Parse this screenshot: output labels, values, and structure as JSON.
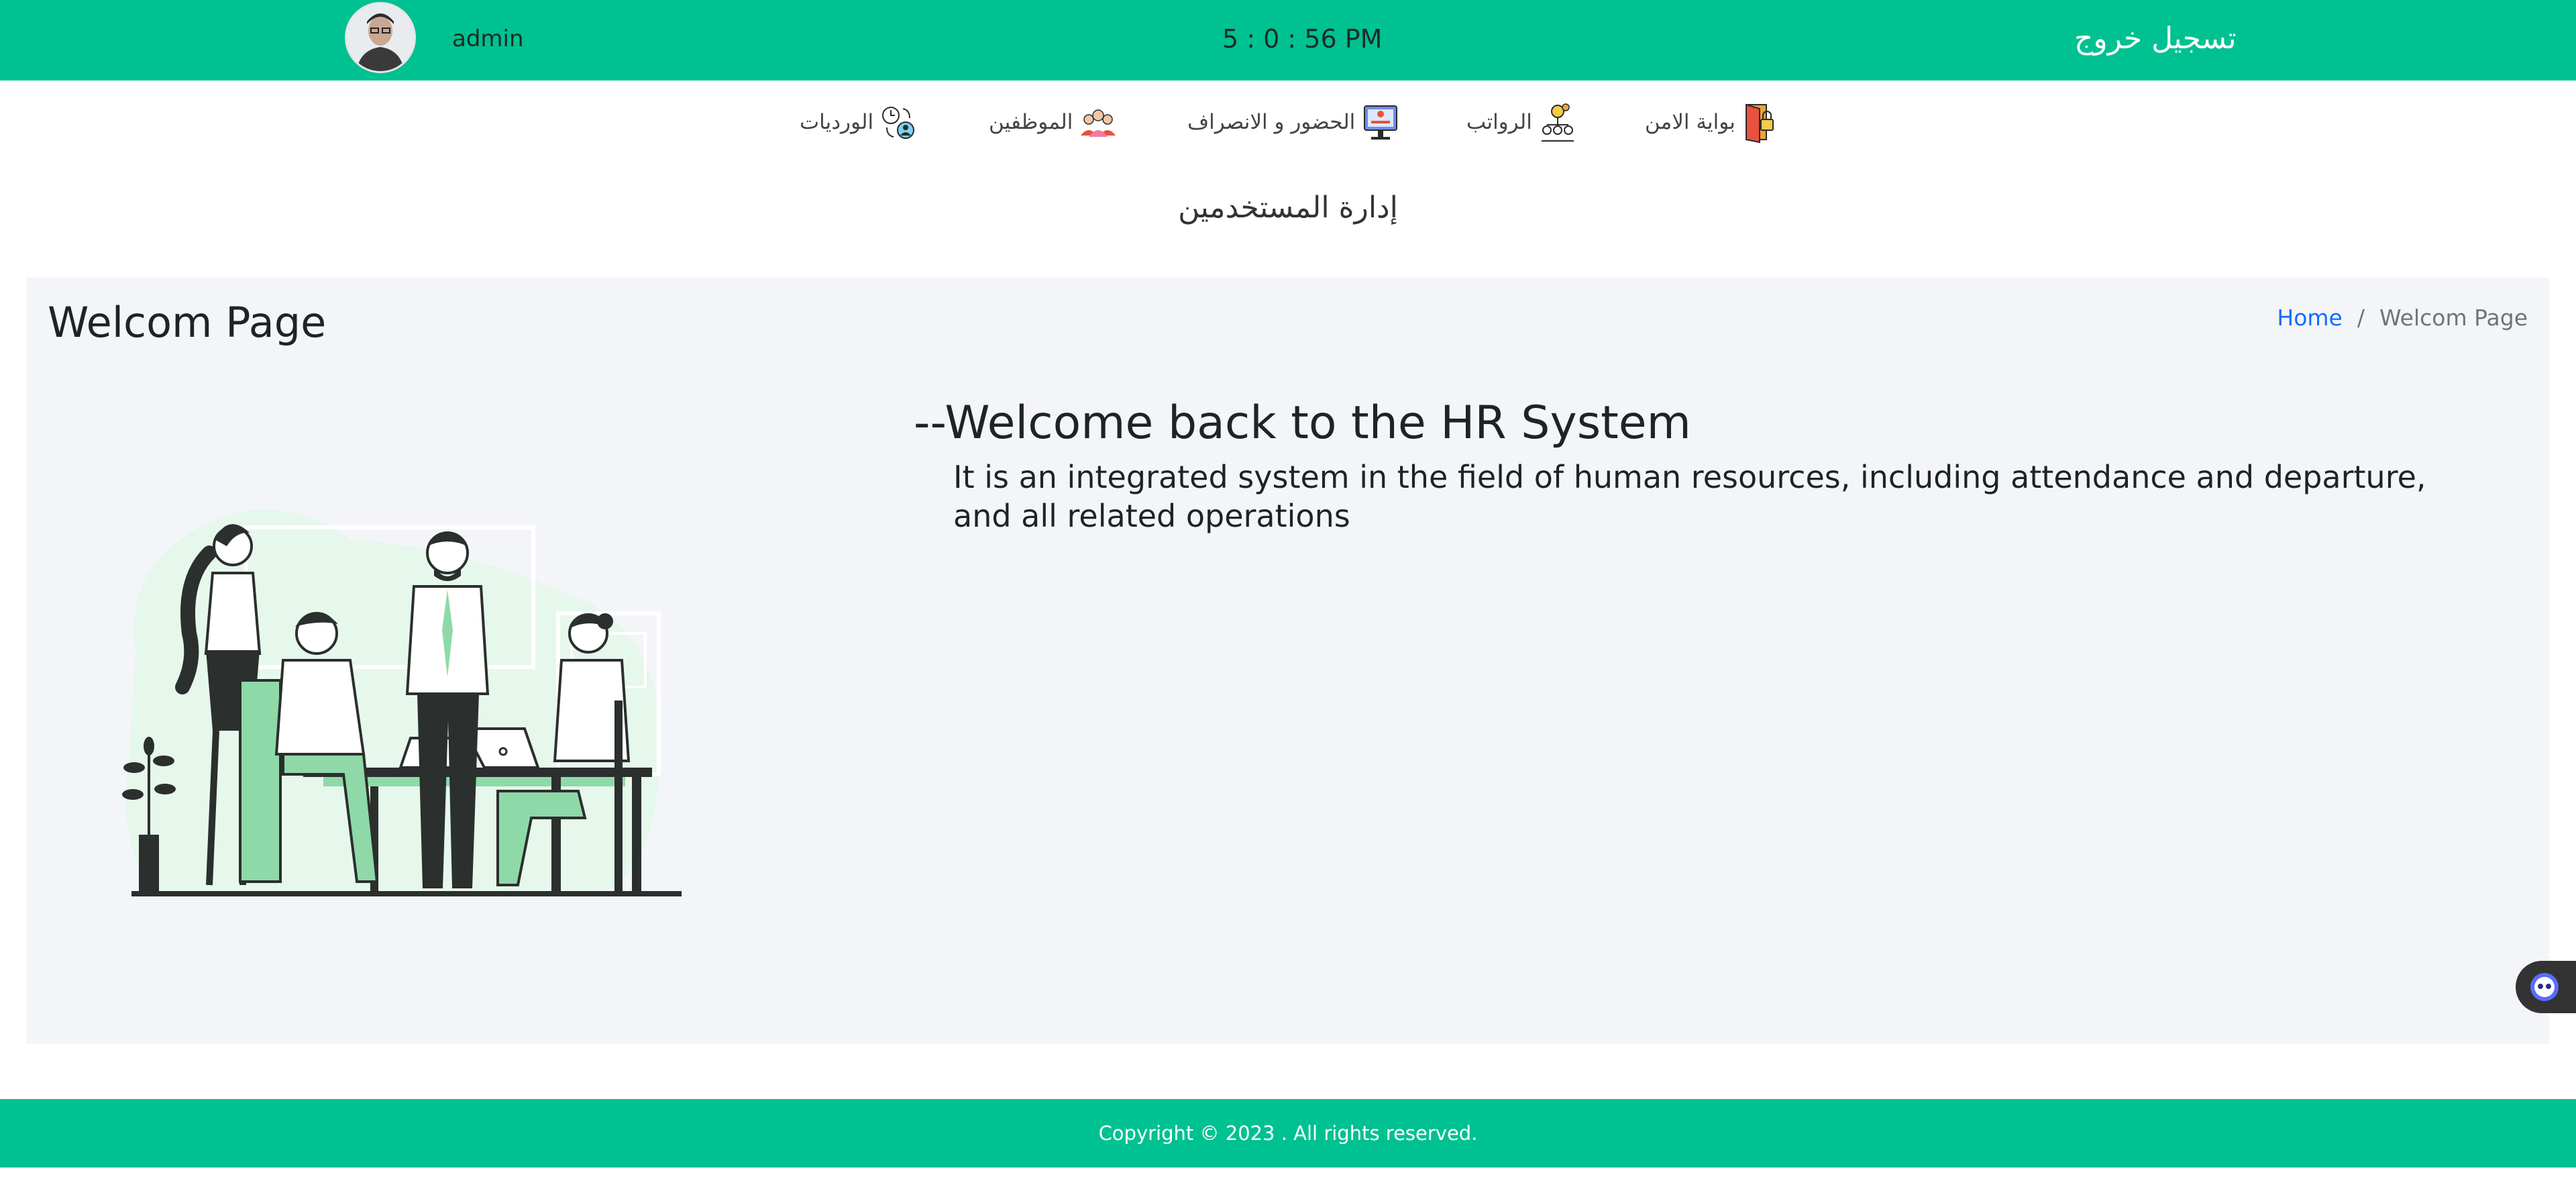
{
  "header": {
    "username": "admin",
    "clock": "5 : 0 : 56 PM",
    "logout_label": "تسجيل خروج"
  },
  "nav": {
    "items": [
      {
        "label": "بواية الامن",
        "icon": "security-door-icon"
      },
      {
        "label": "الرواتب",
        "icon": "salaries-icon"
      },
      {
        "label": "الحضور و الانصراف",
        "icon": "attendance-icon"
      },
      {
        "label": "الموظفين",
        "icon": "employees-icon"
      },
      {
        "label": "الورديات",
        "icon": "shifts-icon"
      }
    ]
  },
  "section": {
    "title": "إدارة المستخدمين"
  },
  "page": {
    "title": "Welcom Page",
    "breadcrumb": {
      "home": "Home",
      "separator": "/",
      "current": "Welcom Page"
    },
    "welcome_title": "--Welcome back to the HR System",
    "welcome_desc": "It is an integrated system in the field of human resources, including attendance and departure, and all related operations"
  },
  "footer": {
    "copyright": "Copyright © 2023 . All rights reserved."
  },
  "colors": {
    "brand": "#00c191",
    "link": "#0d6efd",
    "panel_bg": "#f4f5f9"
  }
}
